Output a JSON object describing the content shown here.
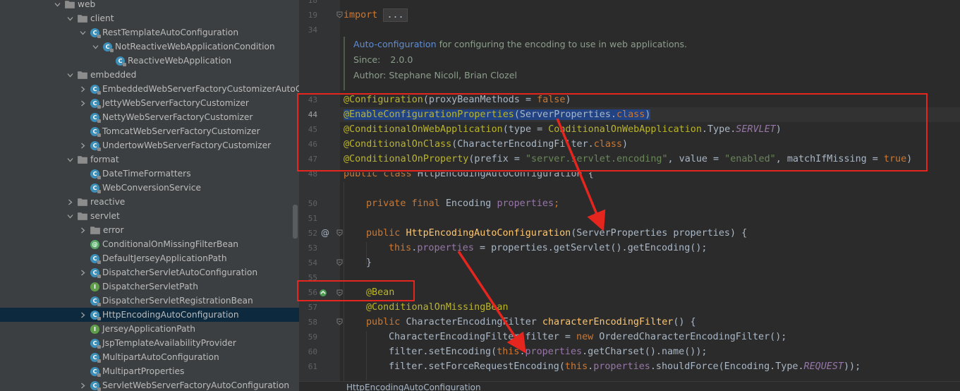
{
  "tree": {
    "items": [
      {
        "label": "web",
        "kind": "folder",
        "level": 4,
        "arrow": "down"
      },
      {
        "label": "client",
        "kind": "folder",
        "level": 5,
        "arrow": "down"
      },
      {
        "label": "RestTemplateAutoConfiguration",
        "kind": "class",
        "level": 6,
        "arrow": "down"
      },
      {
        "label": "NotReactiveWebApplicationCondition",
        "kind": "class",
        "level": 7,
        "arrow": "down"
      },
      {
        "label": "ReactiveWebApplication",
        "kind": "class",
        "level": 8,
        "arrow": "none"
      },
      {
        "label": "embedded",
        "kind": "folder",
        "level": 5,
        "arrow": "down"
      },
      {
        "label": "EmbeddedWebServerFactoryCustomizerAutoConfiguration",
        "kind": "class",
        "level": 6,
        "arrow": "right"
      },
      {
        "label": "JettyWebServerFactoryCustomizer",
        "kind": "class",
        "level": 6,
        "arrow": "right"
      },
      {
        "label": "NettyWebServerFactoryCustomizer",
        "kind": "class",
        "level": 6,
        "arrow": "none"
      },
      {
        "label": "TomcatWebServerFactoryCustomizer",
        "kind": "class",
        "level": 6,
        "arrow": "none"
      },
      {
        "label": "UndertowWebServerFactoryCustomizer",
        "kind": "class",
        "level": 6,
        "arrow": "right"
      },
      {
        "label": "format",
        "kind": "folder",
        "level": 5,
        "arrow": "down"
      },
      {
        "label": "DateTimeFormatters",
        "kind": "class",
        "level": 6,
        "arrow": "none"
      },
      {
        "label": "WebConversionService",
        "kind": "class",
        "level": 6,
        "arrow": "none"
      },
      {
        "label": "reactive",
        "kind": "folder",
        "level": 5,
        "arrow": "right"
      },
      {
        "label": "servlet",
        "kind": "folder",
        "level": 5,
        "arrow": "down"
      },
      {
        "label": "error",
        "kind": "folder",
        "level": 6,
        "arrow": "right"
      },
      {
        "label": "ConditionalOnMissingFilterBean",
        "kind": "annotation",
        "level": 6,
        "arrow": "none"
      },
      {
        "label": "DefaultJerseyApplicationPath",
        "kind": "class",
        "level": 6,
        "arrow": "none"
      },
      {
        "label": "DispatcherServletAutoConfiguration",
        "kind": "class",
        "level": 6,
        "arrow": "right"
      },
      {
        "label": "DispatcherServletPath",
        "kind": "interface",
        "level": 6,
        "arrow": "none"
      },
      {
        "label": "DispatcherServletRegistrationBean",
        "kind": "class",
        "level": 6,
        "arrow": "none"
      },
      {
        "label": "HttpEncodingAutoConfiguration",
        "kind": "class",
        "level": 6,
        "arrow": "right",
        "selected": true
      },
      {
        "label": "JerseyApplicationPath",
        "kind": "interface",
        "level": 6,
        "arrow": "none"
      },
      {
        "label": "JspTemplateAvailabilityProvider",
        "kind": "class",
        "level": 6,
        "arrow": "none"
      },
      {
        "label": "MultipartAutoConfiguration",
        "kind": "class",
        "level": 6,
        "arrow": "none"
      },
      {
        "label": "MultipartProperties",
        "kind": "class",
        "level": 6,
        "arrow": "none"
      },
      {
        "label": "ServletWebServerFactoryAutoConfiguration",
        "kind": "class",
        "level": 6,
        "arrow": "right"
      }
    ]
  },
  "editor": {
    "line_numbers": [
      "18",
      "19",
      "34",
      "43",
      "44",
      "45",
      "46",
      "47",
      "48",
      "50",
      "51",
      "52",
      "53",
      "54",
      "55",
      "56",
      "57",
      "58",
      "59",
      "60",
      "61"
    ],
    "active_line": "44",
    "doc": {
      "link": "Auto-configuration",
      "text": " for configuring the encoding to use in web applications.",
      "since_label": "Since:",
      "since_value": "2.0.0",
      "author": "Author: Stephane Nicoll, Brian Clozel"
    },
    "lines": {
      "import_kw": "import",
      "import_fold": "...",
      "l43_ann": "@Configuration",
      "l43_a": "(proxyBeanMethods = ",
      "l43_b": "false",
      "l43_c": ")",
      "l44_ann": "@EnableConfigurationProperties",
      "l44_a": "(ServerProperties.",
      "l44_b": "class",
      "l44_c": ")",
      "l45_ann": "@ConditionalOnWebApplication",
      "l45_a": "(type = ",
      "l45_b": "ConditionalOnWebApplication",
      "l45_c": ".Type.",
      "l45_d": "SERVLET",
      "l45_e": ")",
      "l46_ann": "@ConditionalOnClass",
      "l46_a": "(CharacterEncodingFilter.",
      "l46_b": "class",
      "l46_c": ")",
      "l47_ann": "@ConditionalOnProperty",
      "l47_a": "(prefix = ",
      "l47_b": "\"server.servlet.encoding\"",
      "l47_c": ", value = ",
      "l47_d": "\"enabled\"",
      "l47_e": ", matchIfMissing = ",
      "l47_f": "true",
      "l47_g": ")",
      "l48_kw": "public class ",
      "l48_a": "HttpEncodingAutoConfiguration {",
      "l50_kw": "private final ",
      "l50_a": "Encoding ",
      "l50_b": "properties",
      "l50_c": ";",
      "l52_kw": "public ",
      "l52_a": "HttpEncodingAutoConfiguration",
      "l52_b": "(ServerProperties properties) {",
      "l53_kw": "this",
      "l53_a": ".",
      "l53_b": "properties",
      "l53_c": " = properties.getServlet().getEncoding();",
      "l54_a": "}",
      "l56_ann": "@Bean",
      "l57_ann": "@ConditionalOnMissingBean",
      "l58_kw": "public ",
      "l58_a": "CharacterEncodingFilter ",
      "l58_b": "characterEncodingFilter",
      "l58_c": "() {",
      "l59_a": "CharacterEncodingFilter filter = ",
      "l59_kw": "new ",
      "l59_b": "OrderedCharacterEncodingFilter();",
      "l60_a": "filter.setEncoding(",
      "l60_kw": "this",
      "l60_b": ".",
      "l60_c": "properties",
      "l60_d": ".getCharset().name());",
      "l61_a": "filter.setForceRequestEncoding(",
      "l61_kw": "this",
      "l61_b": ".",
      "l61_c": "properties",
      "l61_d": ".shouldForce(Encoding.Type.",
      "l61_e": "REQUEST",
      "l61_f": "));"
    },
    "gutter_icons": {
      "line52": "@"
    }
  },
  "breadcrumb": {
    "path": "HttpEncodingAutoConfiguration"
  },
  "colors": {
    "annotation_box": "#e5261f",
    "selection": "#214283",
    "tree_selected": "#0d293e"
  }
}
